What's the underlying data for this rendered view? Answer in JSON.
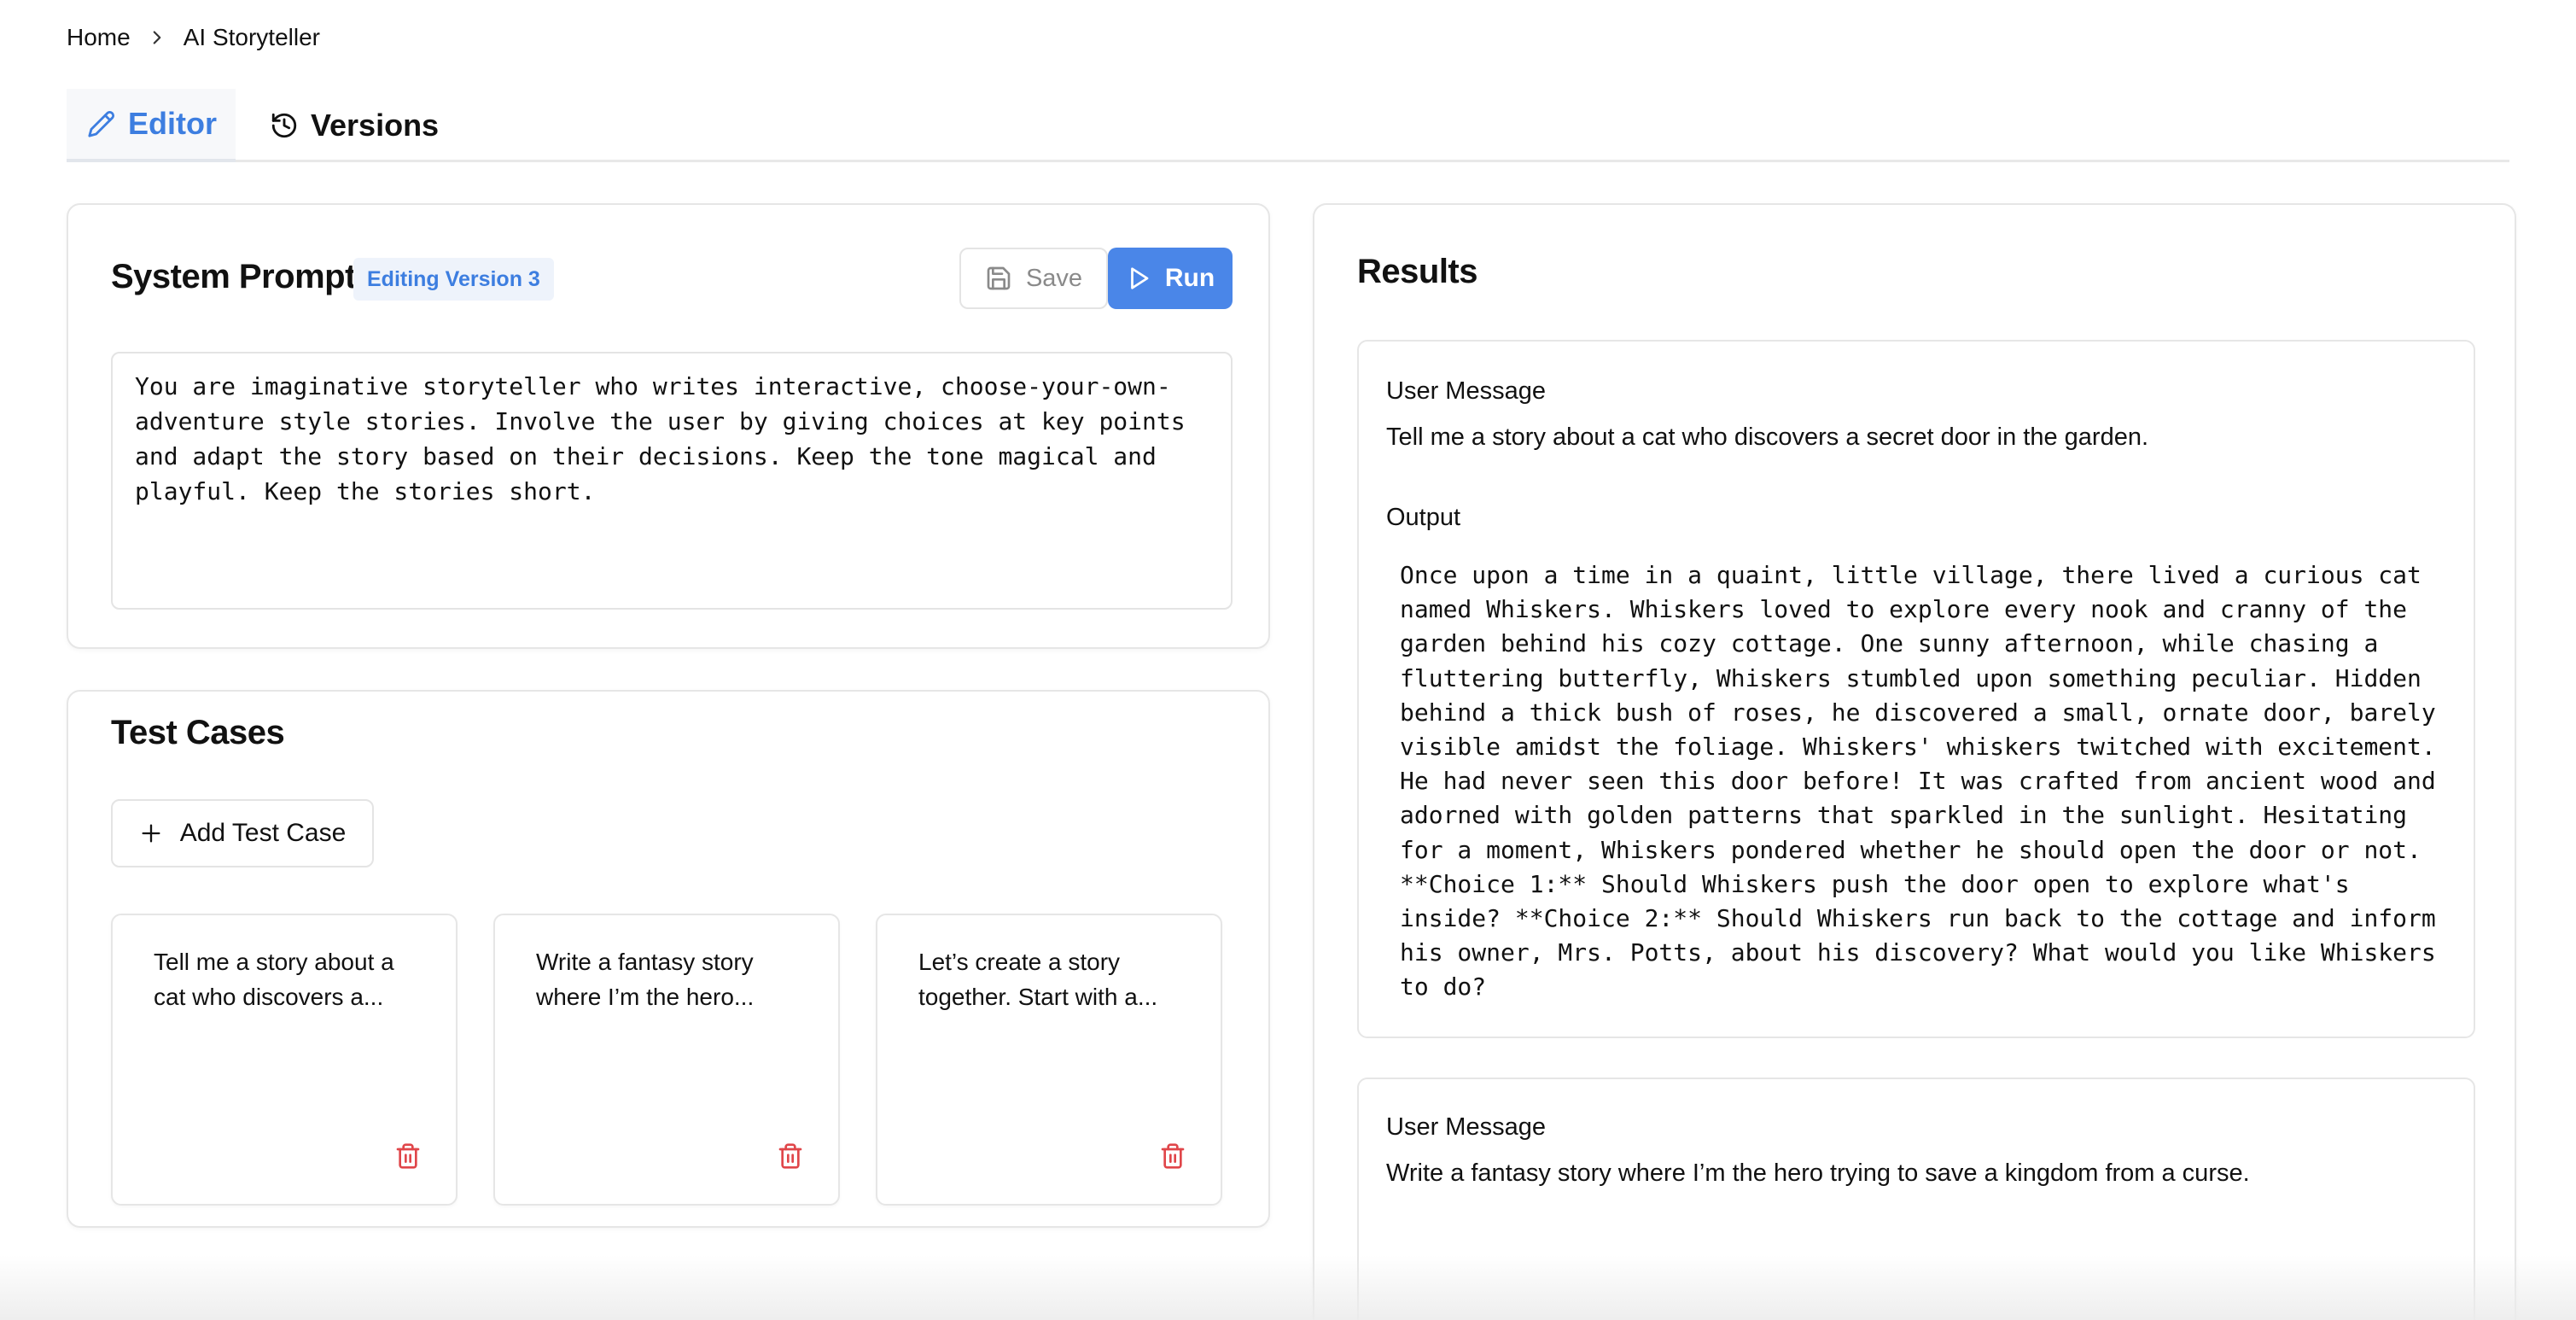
{
  "breadcrumb": {
    "home": "Home",
    "current": "AI Storyteller"
  },
  "tabs": {
    "editor": "Editor",
    "versions": "Versions",
    "active": "Editor"
  },
  "system_prompt": {
    "title": "System Prompt",
    "badge": "Editing Version 3",
    "save_label": "Save",
    "run_label": "Run",
    "text": "You are imaginative storyteller who writes interactive, choose-your-own-adventure style stories. Involve the user by giving choices at key points and adapt the story based on their decisions. Keep the tone magical and playful. Keep the stories short."
  },
  "test_cases": {
    "title": "Test Cases",
    "add_label": "Add Test Case",
    "items": [
      {
        "text": "Tell me a story about a cat who discovers a..."
      },
      {
        "text": "Write a fantasy story where I’m the hero..."
      },
      {
        "text": "Let’s create a story together. Start with a..."
      }
    ]
  },
  "results": {
    "title": "Results",
    "items": [
      {
        "user_message_label": "User Message",
        "user_message": "Tell me a story about a cat who discovers a secret door in the garden.",
        "output_label": "Output",
        "output": "Once upon a time in a quaint, little village, there lived a curious cat named Whiskers. Whiskers loved to explore every nook and cranny of the garden behind his cozy cottage. One sunny afternoon, while chasing a fluttering butterfly, Whiskers stumbled upon something peculiar. Hidden behind a thick bush of roses, he discovered a small, ornate door, barely visible amidst the foliage. Whiskers' whiskers twitched with excitement. He had never seen this door before! It was crafted from ancient wood and adorned with golden patterns that sparkled in the sunlight. Hesitating for a moment, Whiskers pondered whether he should open the door or not. **Choice 1:** Should Whiskers push the door open to explore what's inside? **Choice 2:** Should Whiskers run back to the cottage and inform his owner, Mrs. Potts, about his discovery? What would you like Whiskers to do?"
      },
      {
        "user_message_label": "User Message",
        "user_message": "Write a fantasy story where I’m the hero trying to save a kingdom from a curse."
      }
    ]
  },
  "colors": {
    "accent": "#4a86e8",
    "accent_text": "#3d7ee0",
    "badge_bg": "#eef3fb",
    "delete": "#e0464a",
    "border": "#e6e6e6"
  }
}
